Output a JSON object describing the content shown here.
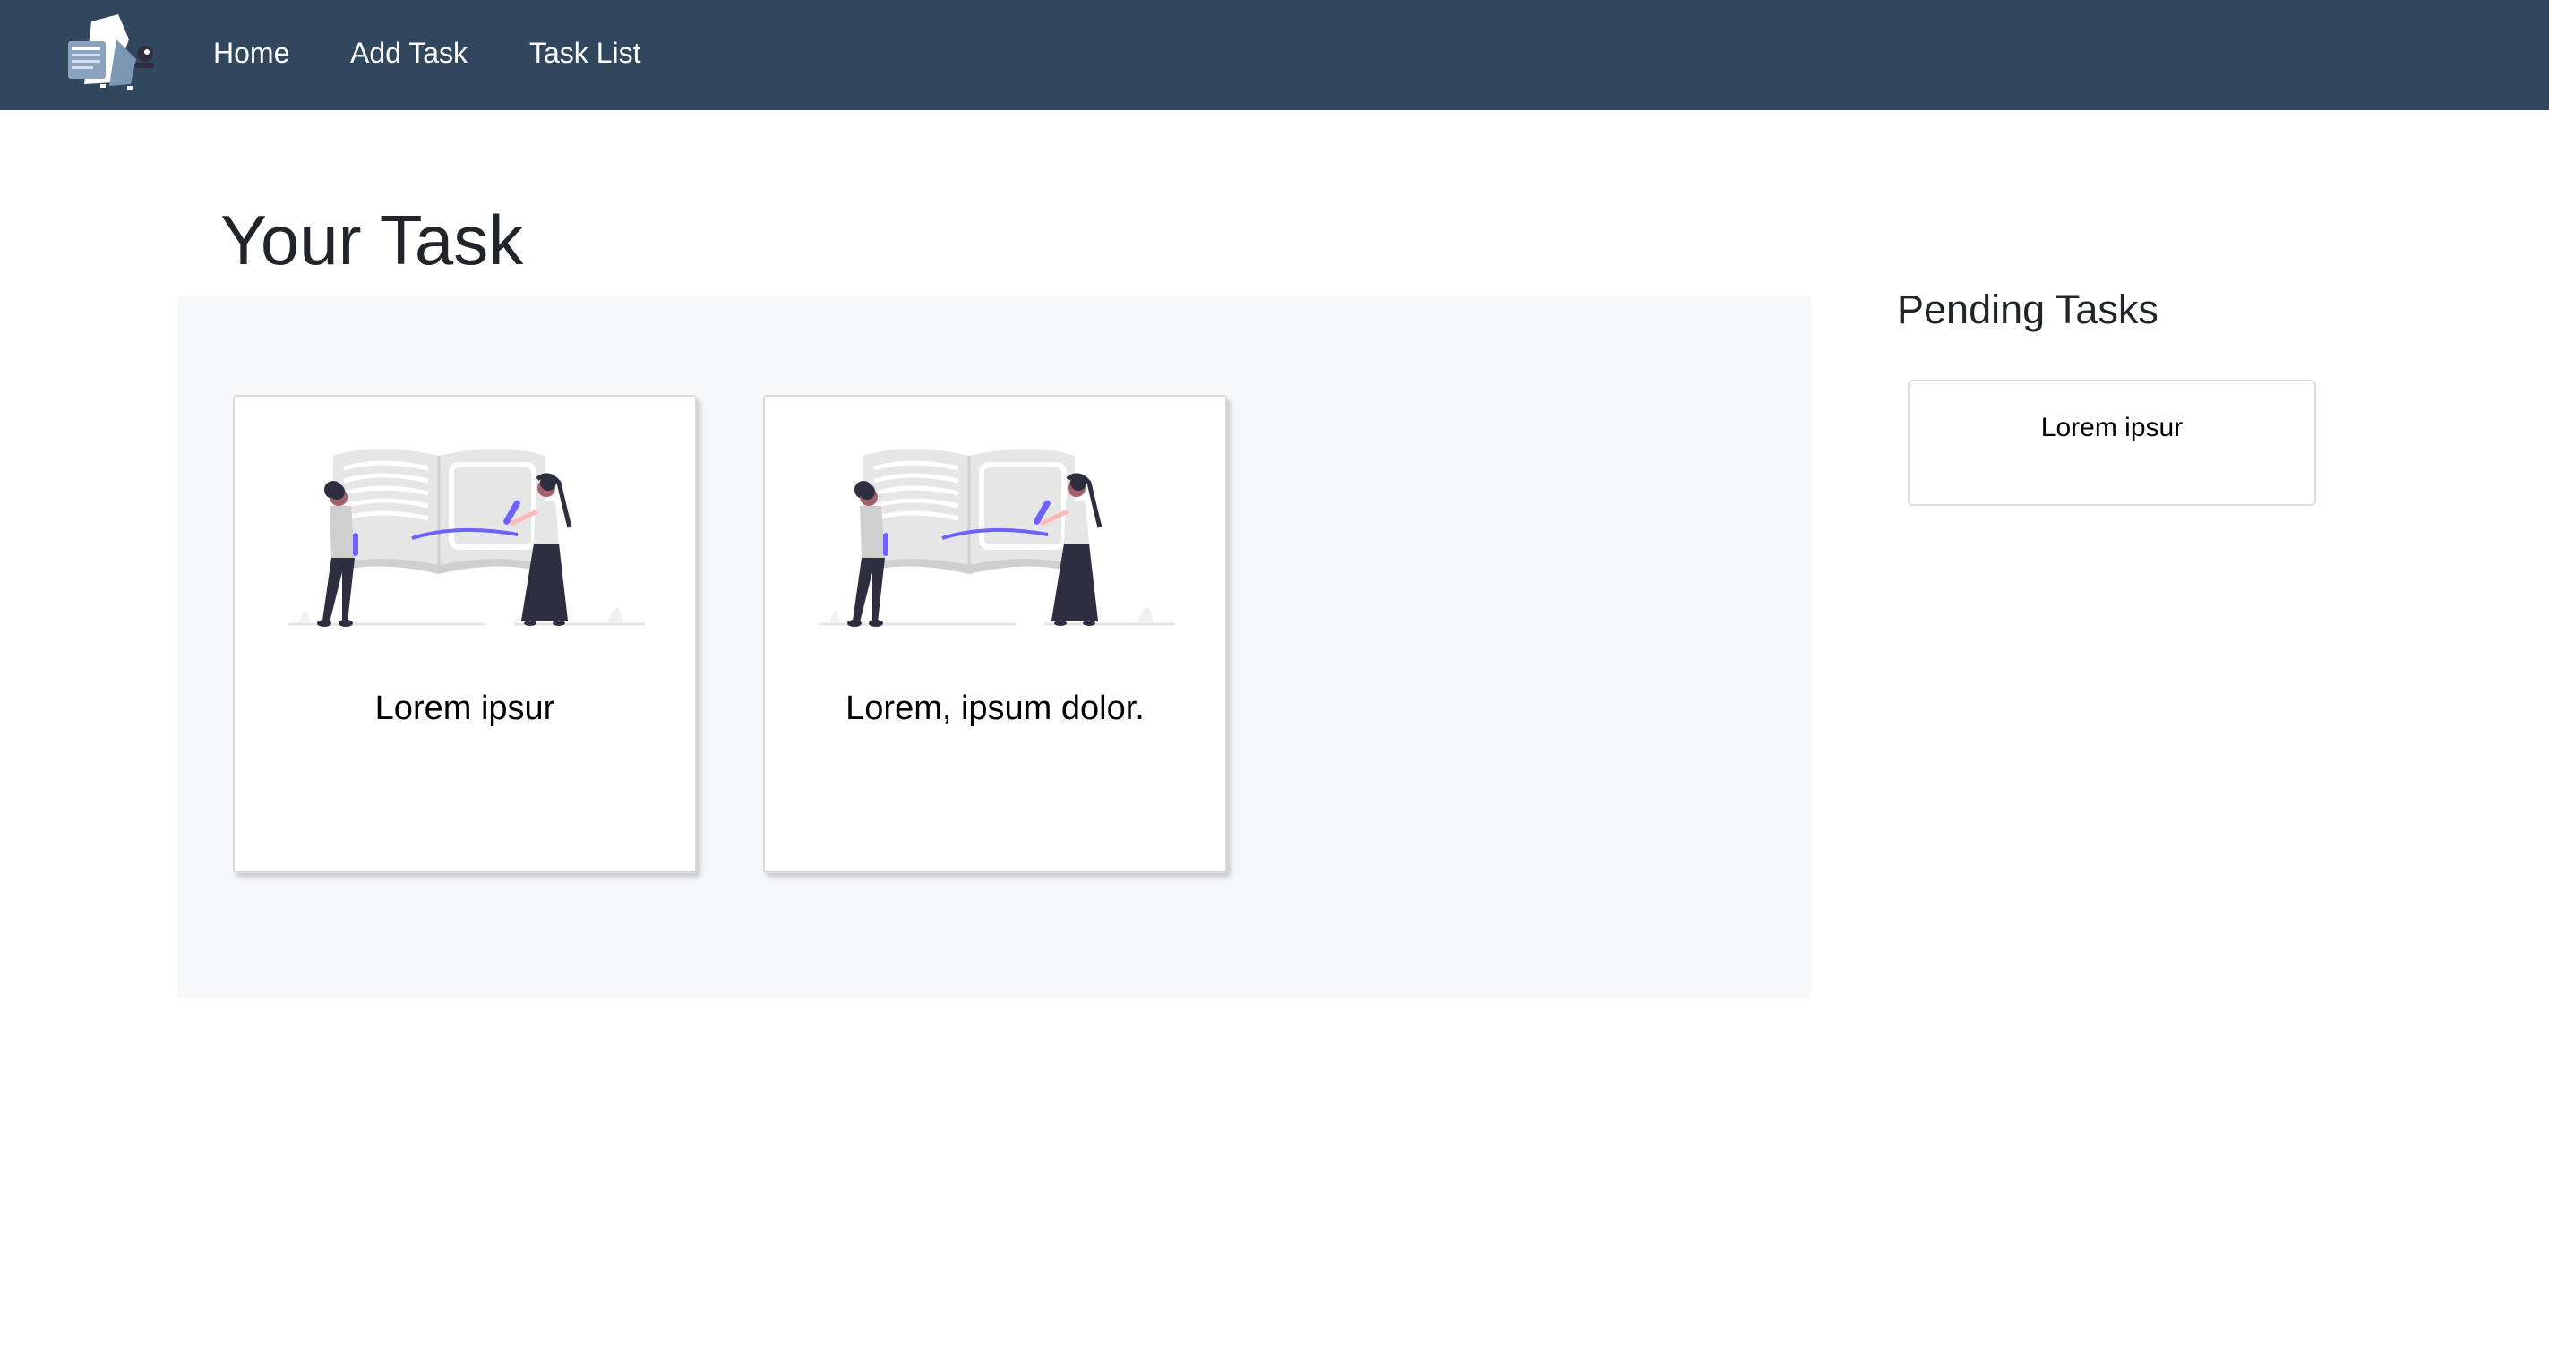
{
  "colors": {
    "navbar": "#30475e",
    "panel": "#f7f8f9",
    "accent_purple": "#6c63ff",
    "figure_dark": "#2f2e41"
  },
  "nav": {
    "logo_icon": "brand-logo-icon",
    "links": [
      {
        "label": "Home"
      },
      {
        "label": "Add Task"
      },
      {
        "label": "Task List"
      }
    ]
  },
  "main": {
    "title": "Your Task",
    "tasks": [
      {
        "title": "Lorem ipsur",
        "illustration": "reading-book-illustration"
      },
      {
        "title": "Lorem, ipsum dolor.",
        "illustration": "reading-book-illustration"
      }
    ]
  },
  "sidebar": {
    "title": "Pending Tasks",
    "items": [
      {
        "label": "Lorem ipsur"
      }
    ]
  }
}
